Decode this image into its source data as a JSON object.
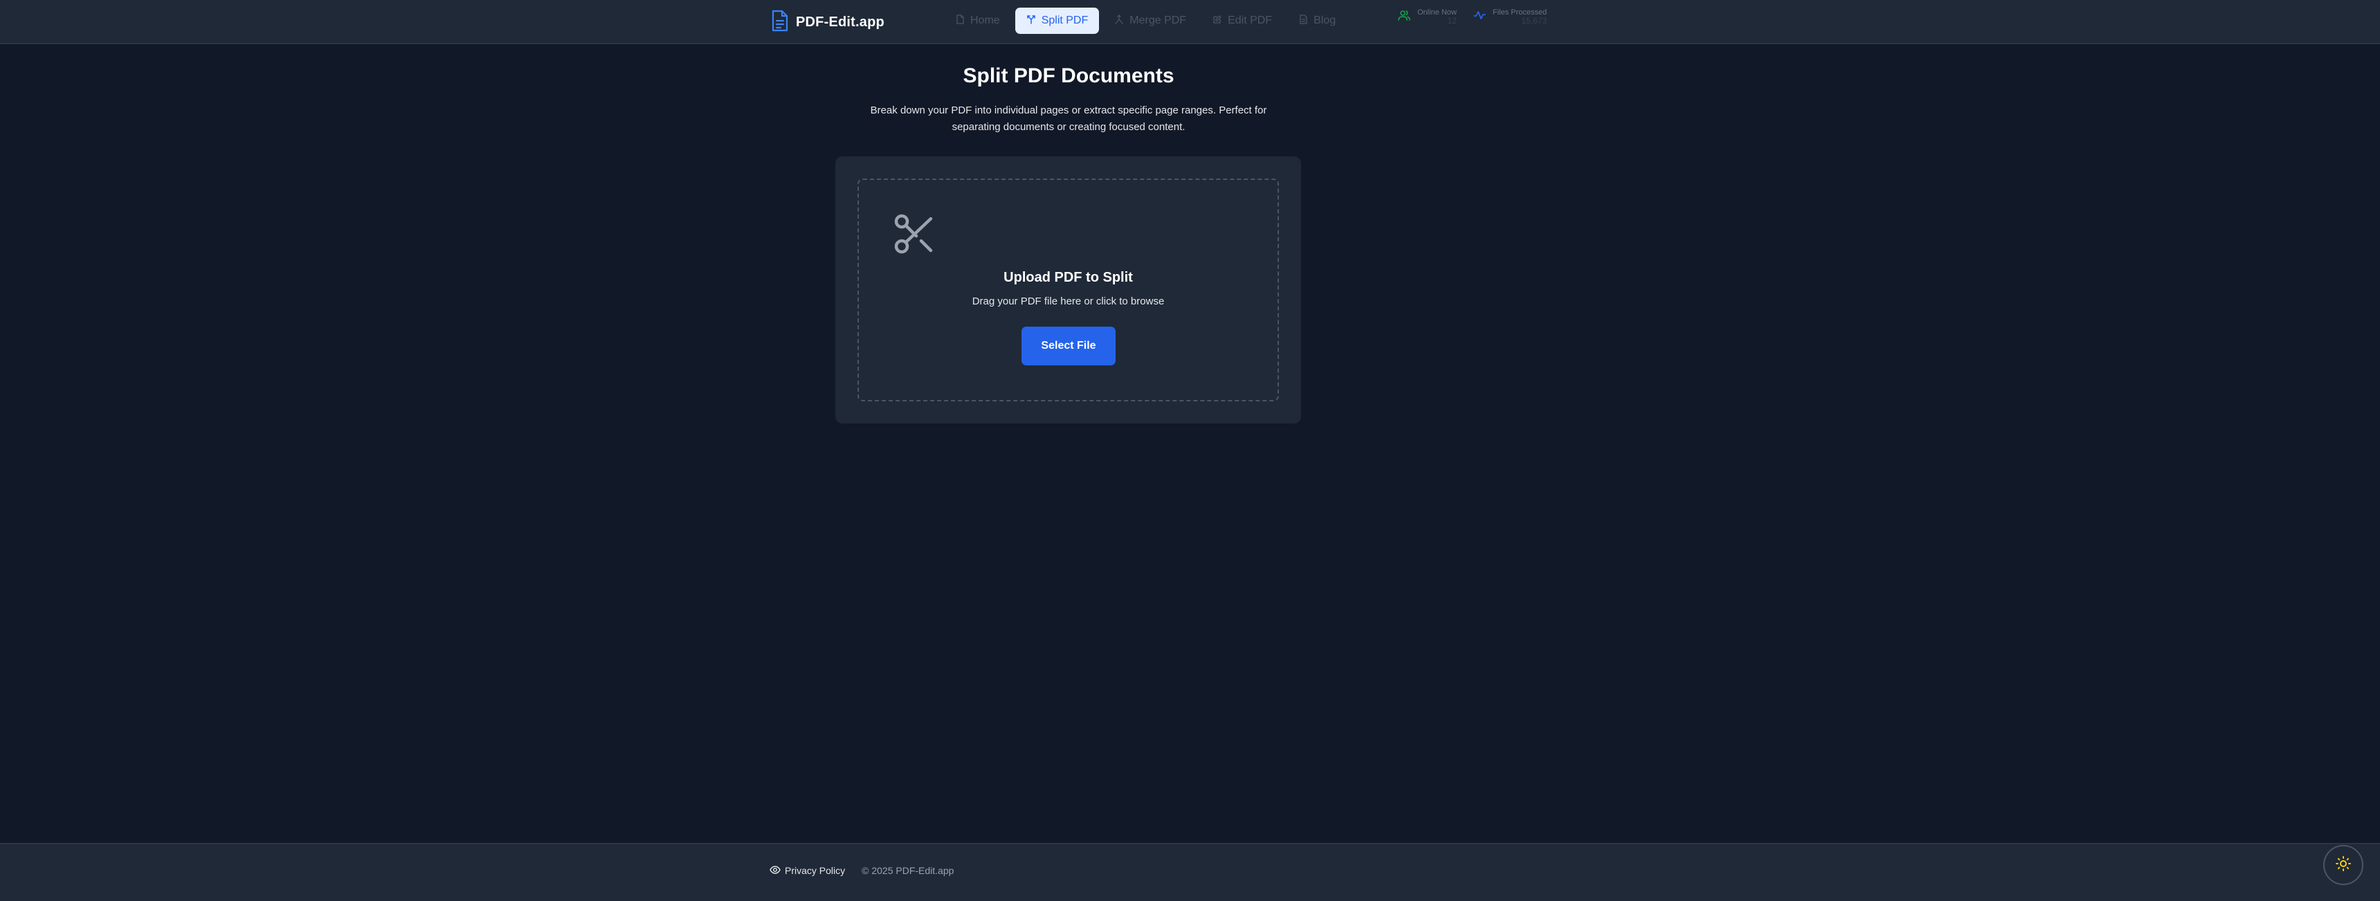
{
  "header": {
    "brand_name": "PDF-Edit.app",
    "nav": [
      {
        "label": "Home",
        "icon": "file-icon",
        "active": false
      },
      {
        "label": "Split PDF",
        "icon": "split-icon",
        "active": true
      },
      {
        "label": "Merge PDF",
        "icon": "merge-icon",
        "active": false
      },
      {
        "label": "Edit PDF",
        "icon": "edit-icon",
        "active": false
      },
      {
        "label": "Blog",
        "icon": "file-text-icon",
        "active": false
      }
    ],
    "stats": [
      {
        "label": "Online Now",
        "value": "12",
        "icon": "users-icon",
        "color": "#16a34a"
      },
      {
        "label": "Files Processed",
        "value": "15,673",
        "icon": "activity-icon",
        "color": "#2563eb"
      }
    ]
  },
  "main": {
    "title": "Split PDF Documents",
    "subtitle": "Break down your PDF into individual pages or extract specific page ranges. Perfect for separating documents or creating focused content.",
    "upload": {
      "icon": "scissors-icon",
      "title": "Upload PDF to Split",
      "hint": "Drag your PDF file here or click to browse",
      "button_label": "Select File"
    }
  },
  "footer": {
    "privacy_label": "Privacy Policy",
    "copyright": "© 2025 PDF-Edit.app"
  },
  "theme_toggle": {
    "icon": "sun-icon"
  },
  "colors": {
    "background": "#111827",
    "surface": "#1f2937",
    "accent": "#2563eb",
    "active_nav_bg": "#e5efff",
    "theme_icon": "#facc15"
  }
}
